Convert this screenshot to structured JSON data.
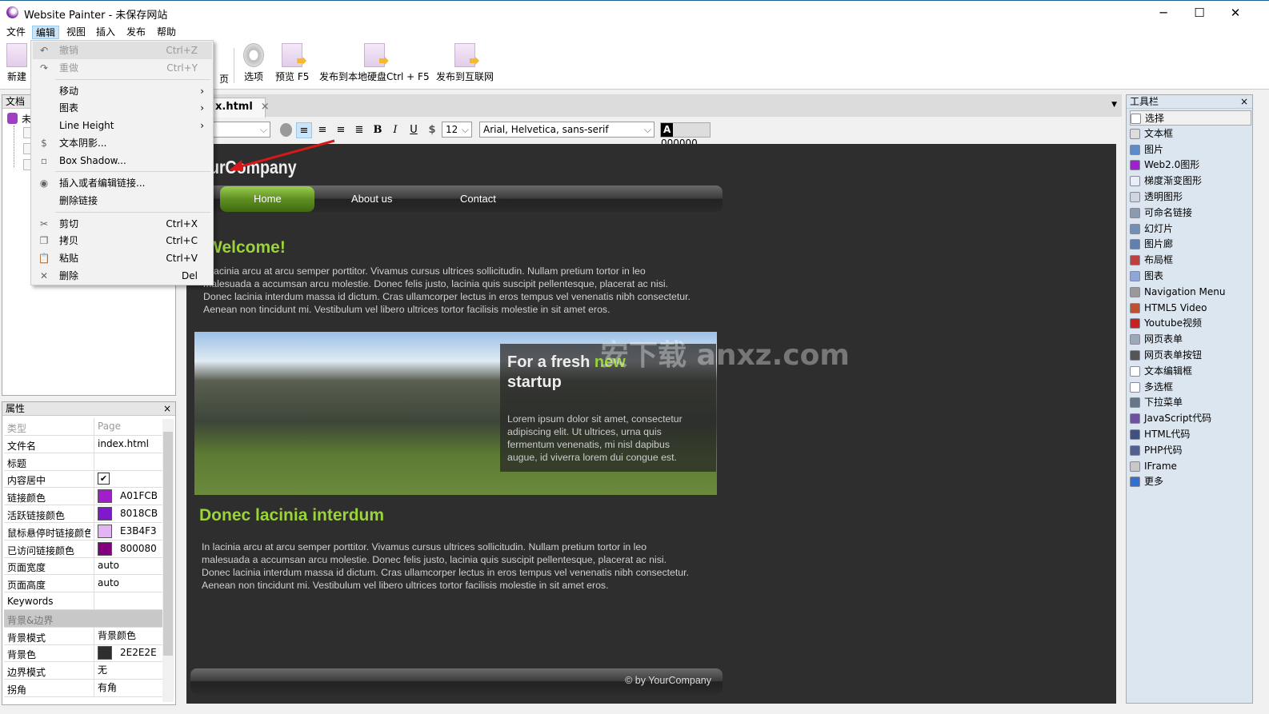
{
  "window": {
    "title": "Website Painter - 未保存网站",
    "min": "─",
    "max": "☐",
    "close": "✕"
  },
  "menubar": [
    "文件",
    "编辑",
    "视图",
    "插入",
    "发布",
    "帮助"
  ],
  "toolbar": [
    {
      "label": "新建"
    },
    {
      "label": "网页"
    },
    {
      "label": "选项"
    },
    {
      "label": "预览 F5"
    },
    {
      "label": "发布到本地硬盘Ctrl + F5"
    },
    {
      "label": "发布到互联网"
    }
  ],
  "edit_menu": {
    "items": [
      {
        "label": "撤销",
        "shortcut": "Ctrl+Z",
        "icon": "undo-icon",
        "disabled": true
      },
      {
        "label": "重做",
        "shortcut": "Ctrl+Y",
        "icon": "redo-icon",
        "disabled": true
      },
      {
        "label": "移动",
        "submenu": true
      },
      {
        "label": "图表",
        "submenu": true
      },
      {
        "label": "Line Height",
        "submenu": true
      },
      {
        "label": "文本阴影...",
        "icon": "dollar-shadow-icon"
      },
      {
        "label": "Box Shadow...",
        "icon": "box-shadow-icon"
      },
      {
        "label": "插入或者编辑链接...",
        "icon": "globe-link-icon"
      },
      {
        "label": "删除链接"
      },
      {
        "label": "剪切",
        "shortcut": "Ctrl+X",
        "icon": "scissors-icon"
      },
      {
        "label": "拷贝",
        "shortcut": "Ctrl+C",
        "icon": "copy-icon"
      },
      {
        "label": "粘贴",
        "shortcut": "Ctrl+V",
        "icon": "paste-icon"
      },
      {
        "label": "删除",
        "shortcut": "Del",
        "icon": "close-icon"
      }
    ]
  },
  "doc_panel": {
    "title": "文档",
    "root": "未"
  },
  "props_panel": {
    "title": "属性",
    "close": "×",
    "rows": [
      {
        "k": "类型",
        "v": "Page",
        "muted": true
      },
      {
        "k": "文件名",
        "v": "index.html"
      },
      {
        "k": "标题",
        "v": ""
      },
      {
        "k": "内容居中",
        "v": "✔",
        "checkbox": true
      },
      {
        "k": "链接颜色",
        "v": "A01FCB",
        "color": "#A01FCB"
      },
      {
        "k": "活跃链接颜色",
        "v": "8018CB",
        "color": "#8018CB"
      },
      {
        "k": "鼠标悬停时链接颜色",
        "v": "E3B4F3",
        "color": "#E3B4F3"
      },
      {
        "k": "已访问链接颜色",
        "v": "800080",
        "color": "#800080"
      },
      {
        "k": "页面宽度",
        "v": "auto"
      },
      {
        "k": "页面高度",
        "v": "auto"
      },
      {
        "k": "Keywords",
        "v": ""
      },
      {
        "k": "背景&边界",
        "v": "",
        "section": true
      },
      {
        "k": "背景模式",
        "v": "背景颜色"
      },
      {
        "k": "背景色",
        "v": "2E2E2E",
        "color": "#2E2E2E"
      },
      {
        "k": "边界模式",
        "v": "无"
      },
      {
        "k": "拐角",
        "v": "有角"
      }
    ]
  },
  "editor": {
    "tab": "x.html",
    "tab_close": "×",
    "font_size": "12",
    "font_family": "Arial, Helvetica, sans-serif",
    "color": "000000",
    "color_label": "A",
    "fmt": [
      "B",
      "I",
      "U",
      "$"
    ]
  },
  "site": {
    "logo": "urCompany",
    "nav": [
      "Home",
      "About us",
      "Contact"
    ],
    "welcome": "Welcome!",
    "para1": [
      "n lacinia arcu at arcu semper porttitor. Vivamus cursus ultrices sollicitudin. Nullam pretium tortor in leo",
      "malesuada a accumsan arcu molestie. Donec felis justo, lacinia quis suscipit pellentesque, placerat ac nisi.",
      "Donec lacinia interdum massa id dictum. Cras ullamcorper lectus in eros tempus vel venenatis nibh consectetur.",
      "Aenean non tincidunt mi. Vestibulum vel libero ultrices tortor facilisis molestie in sit amet eros."
    ],
    "banner_title_1": "For a fresh ",
    "banner_title_new": "new",
    "banner_title_2": "startup",
    "banner_text": [
      "Lorem ipsum dolor sit amet, consectetur",
      "adipiscing elit. Ut ultrices, urna quis",
      "fermentum venenatis, mi nisl dapibus",
      "augue, id viverra lorem dui congue est."
    ],
    "heading2": "Donec lacinia interdum",
    "para2": [
      "In lacinia arcu at arcu semper porttitor. Vivamus cursus ultrices sollicitudin. Nullam pretium tortor in leo",
      "malesuada a accumsan arcu molestie. Donec felis justo, lacinia quis suscipit pellentesque, placerat ac nisi.",
      "Donec lacinia interdum massa id dictum. Cras ullamcorper lectus in eros tempus vel venenatis nibh consectetur.",
      "Aenean non tincidunt mi. Vestibulum vel libero ultrices tortor facilisis molestie in sit amet eros."
    ],
    "footer": "© by YourCompany",
    "watermark": "安下载 anxz.com"
  },
  "tools_panel": {
    "title": "工具栏",
    "close": "×",
    "items": [
      {
        "label": "选择",
        "color": "#ffffff"
      },
      {
        "label": "文本框",
        "color": "#dddddd"
      },
      {
        "label": "图片",
        "color": "#5b8bc9"
      },
      {
        "label": "Web2.0图形",
        "color": "#a020d0"
      },
      {
        "label": "梯度渐变图形",
        "color": "#e8eef5"
      },
      {
        "label": "透明图形",
        "color": "#cfd6de"
      },
      {
        "label": "可命名链接",
        "color": "#8a9ab0"
      },
      {
        "label": "幻灯片",
        "color": "#7090b8"
      },
      {
        "label": "图片廊",
        "color": "#6080b0"
      },
      {
        "label": "布局框",
        "color": "#c04040"
      },
      {
        "label": "图表",
        "color": "#8fa6d8"
      },
      {
        "label": "Navigation Menu",
        "color": "#999999"
      },
      {
        "label": "HTML5 Video",
        "color": "#c05030"
      },
      {
        "label": "Youtube视频",
        "color": "#cc2020"
      },
      {
        "label": "网页表单",
        "color": "#9aa8b8"
      },
      {
        "label": "网页表单按钮",
        "color": "#555555"
      },
      {
        "label": "文本编辑框",
        "color": "#ffffff"
      },
      {
        "label": "多选框",
        "color": "#ffffff"
      },
      {
        "label": "下拉菜单",
        "color": "#667788"
      },
      {
        "label": "JavaScript代码",
        "color": "#7050a0"
      },
      {
        "label": "HTML代码",
        "color": "#405080"
      },
      {
        "label": "PHP代码",
        "color": "#506090"
      },
      {
        "label": "IFrame",
        "color": "#c8c8c8"
      },
      {
        "label": "更多",
        "color": "#3070d0"
      }
    ]
  }
}
